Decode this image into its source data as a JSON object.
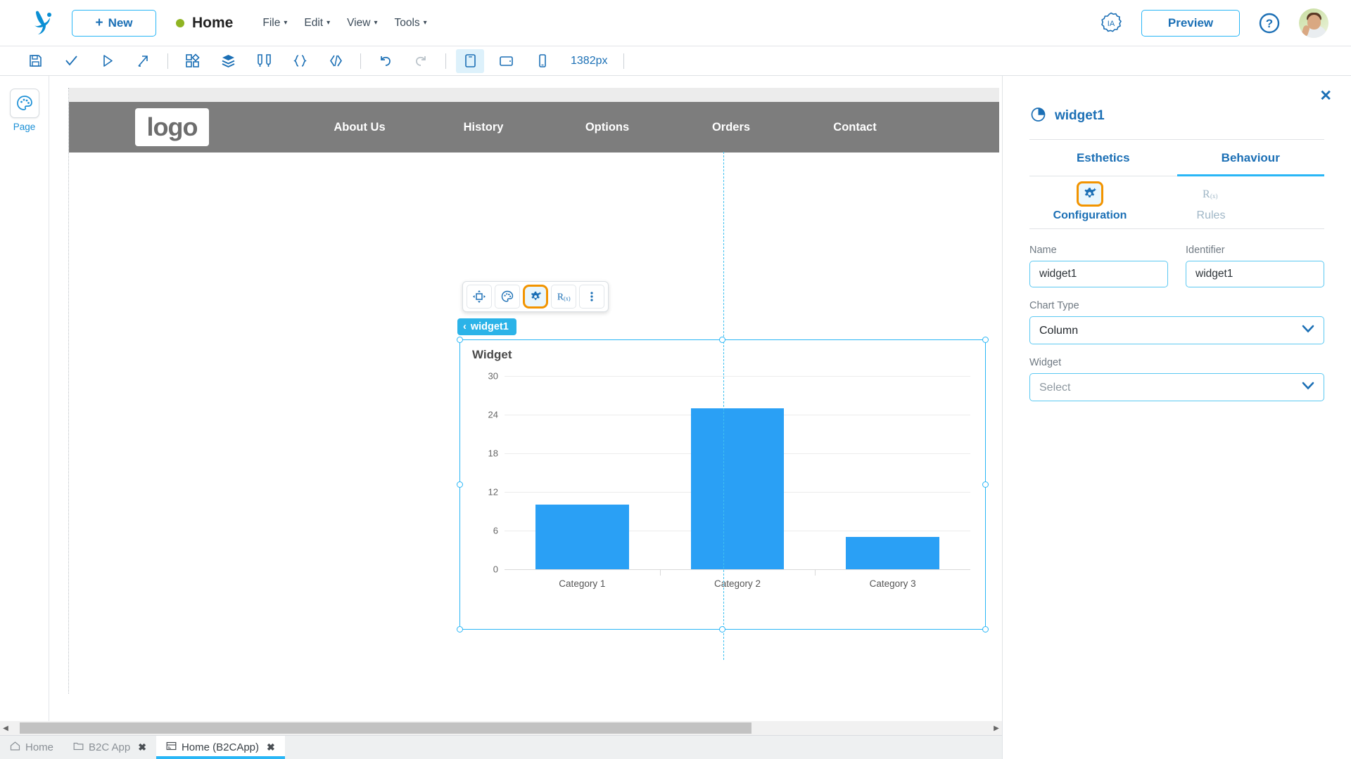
{
  "header": {
    "logo_icon": "app-paw-logo",
    "new_button": {
      "label": "New",
      "plus": "+"
    },
    "page_status_label": "Home",
    "status_color": "#8fb422",
    "menus": [
      {
        "label": "File",
        "caret": "⌄"
      },
      {
        "label": "Edit",
        "caret": "⌄"
      },
      {
        "label": "View",
        "caret": "⌄"
      },
      {
        "label": "Tools",
        "caret": "⌄"
      }
    ],
    "ia_badge_label": "IA",
    "preview_button": "Preview",
    "help_icon": "question-circle-icon",
    "avatar_icon": "user-avatar"
  },
  "toolbar": {
    "buttons": [
      {
        "name": "save-icon"
      },
      {
        "name": "validate-check-icon"
      },
      {
        "name": "run-play-icon"
      },
      {
        "name": "deploy-export-icon"
      },
      {
        "name": "components-grid-icon"
      },
      {
        "name": "layers-icon"
      },
      {
        "name": "variables-sliders-icon"
      },
      {
        "name": "braces-icon"
      },
      {
        "name": "code-icon"
      },
      {
        "name": "undo-icon"
      },
      {
        "name": "redo-icon"
      },
      {
        "name": "desktop-view-icon"
      },
      {
        "name": "tablet-view-icon"
      },
      {
        "name": "mobile-view-icon"
      }
    ],
    "viewport_size": "1382px"
  },
  "left_rail": {
    "items": [
      {
        "label": "Page",
        "icon": "palette-icon"
      }
    ]
  },
  "canvas": {
    "site_logo_text": "logo",
    "nav_links": [
      "About Us",
      "History",
      "Options",
      "Orders",
      "Contact"
    ],
    "widget_badge": {
      "chevron": "‹",
      "label": "widget1"
    },
    "float_toolbar": [
      {
        "name": "move-resize-icon",
        "highlighted": false
      },
      {
        "name": "palette-esthetics-icon",
        "highlighted": false
      },
      {
        "name": "configuration-gear-icon",
        "highlighted": true
      },
      {
        "name": "rules-rx-icon",
        "highlighted": false
      },
      {
        "name": "more-options-icon",
        "highlighted": false
      }
    ]
  },
  "chart_data": {
    "type": "bar",
    "title": "Widget",
    "categories": [
      "Category 1",
      "Category 2",
      "Category 3"
    ],
    "values": [
      10,
      25,
      5
    ],
    "series": [
      {
        "name": "Widget",
        "values": [
          10,
          25,
          5
        ]
      }
    ],
    "xlabel": "",
    "ylabel": "",
    "ylim": [
      0,
      30
    ],
    "yticks": [
      0,
      6,
      12,
      18,
      24,
      30
    ],
    "grid": true,
    "legend": "none",
    "bar_color": "#2aa0f5"
  },
  "right_panel": {
    "close_label": "✕",
    "title": "widget1",
    "title_icon": "pie-chart-icon",
    "tabs": [
      {
        "label": "Esthetics",
        "active": false
      },
      {
        "label": "Behaviour",
        "active": true
      }
    ],
    "subtabs": [
      {
        "label": "Configuration",
        "icon": "configuration-gear-icon",
        "active": true
      },
      {
        "label": "Rules",
        "icon": "rules-rx-icon",
        "active": false
      }
    ],
    "fields": {
      "name_label": "Name",
      "name_value": "widget1",
      "identifier_label": "Identifier",
      "identifier_value": "widget1",
      "chart_type_label": "Chart Type",
      "chart_type_value": "Column",
      "widget_label": "Widget",
      "widget_placeholder": "Select"
    }
  },
  "bottom": {
    "scroll_left_arrow": "◀",
    "scroll_right_arrow": "▶",
    "tabs": [
      {
        "label": "Home",
        "icon": "home-icon",
        "closable": false,
        "active": false
      },
      {
        "label": "B2C App",
        "icon": "folder-icon",
        "closable": true,
        "active": false
      },
      {
        "label": "Home (B2CApp)",
        "icon": "page-icon",
        "closable": true,
        "active": true
      }
    ],
    "close_glyph": "✖"
  },
  "colors": {
    "accent_blue": "#29b6f6",
    "link_blue": "#1b6fb5",
    "highlight_orange": "#f29400",
    "bar_blue": "#2aa0f5",
    "nav_gray": "#7d7d7d"
  }
}
